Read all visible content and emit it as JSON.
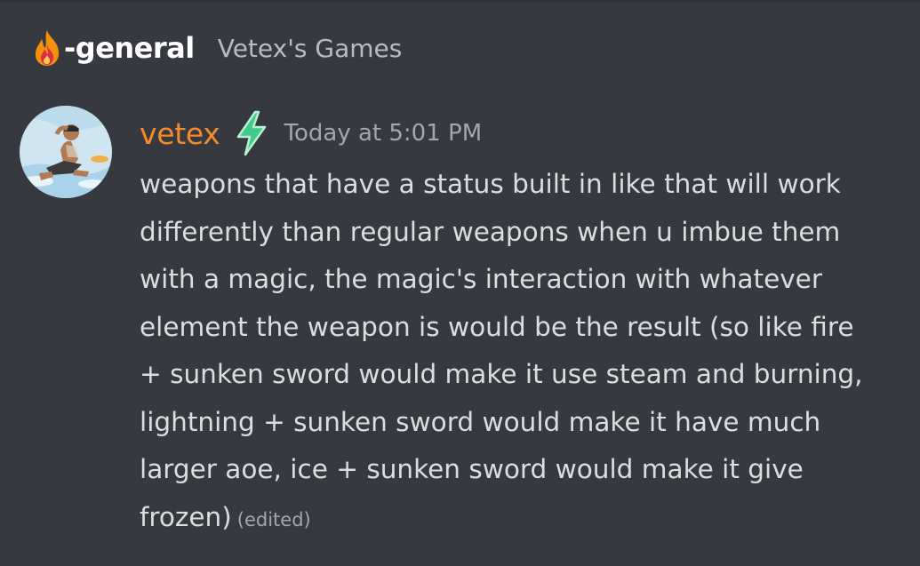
{
  "channel": {
    "icon": "fire-icon",
    "name": "-general",
    "server": "Vetex's Games"
  },
  "message": {
    "avatar": "user-avatar",
    "username": "vetex",
    "username_color": "#f48a2a",
    "badge_icon": "lightning-bolt-icon",
    "badge_color": "#43c98a",
    "timestamp": "Today at 5:01 PM",
    "lines": [
      "weapons that have a status built in like that will work",
      "differently than regular weapons when u imbue them",
      "with a magic, the magic's interaction with whatever",
      "element the weapon is would be the result (so like fire",
      "+ sunken sword would make it use steam and burning,",
      "lightning + sunken sword would make it have much",
      "larger aoe, ice + sunken sword would make it give",
      "frozen)"
    ],
    "edited_label": "(edited)"
  }
}
